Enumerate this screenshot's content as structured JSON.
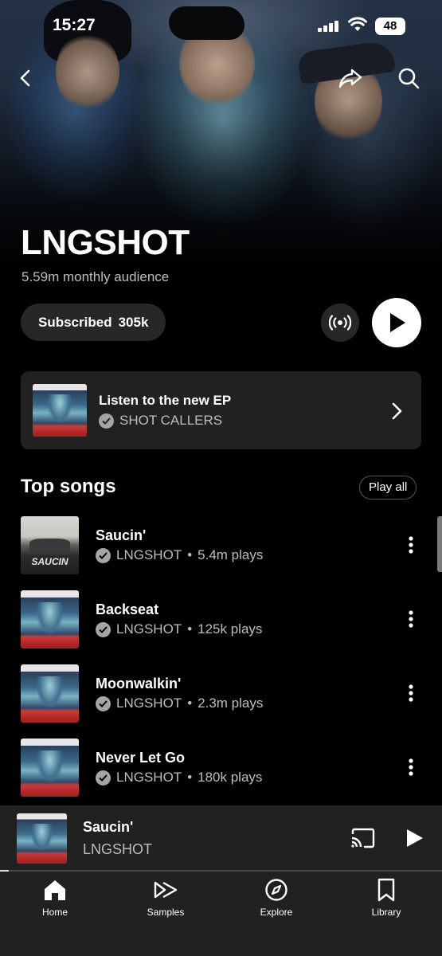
{
  "status_bar": {
    "time": "15:27",
    "battery": "48"
  },
  "artist": {
    "name": "LNGSHOT",
    "audience": "5.59m monthly audience"
  },
  "actions": {
    "subscribe_label": "Subscribed",
    "subscriber_count": "305k"
  },
  "ep_card": {
    "title": "Listen to the new EP",
    "subtitle": "SHOT CALLERS"
  },
  "top_songs": {
    "heading": "Top songs",
    "play_all_label": "Play all",
    "songs": [
      {
        "title": "Saucin'",
        "artist": "LNGSHOT",
        "plays": "5.4m plays"
      },
      {
        "title": "Backseat",
        "artist": "LNGSHOT",
        "plays": "125k plays"
      },
      {
        "title": "Moonwalkin'",
        "artist": "LNGSHOT",
        "plays": "2.3m plays"
      },
      {
        "title": "Never Let Go",
        "artist": "LNGSHOT",
        "plays": "180k plays"
      }
    ]
  },
  "now_playing": {
    "title": "Saucin'",
    "artist": "LNGSHOT",
    "progress": 0.02
  },
  "nav": {
    "items": [
      {
        "label": "Home",
        "icon": "home-icon"
      },
      {
        "label": "Samples",
        "icon": "samples-icon"
      },
      {
        "label": "Explore",
        "icon": "explore-icon"
      },
      {
        "label": "Library",
        "icon": "library-icon"
      }
    ]
  }
}
